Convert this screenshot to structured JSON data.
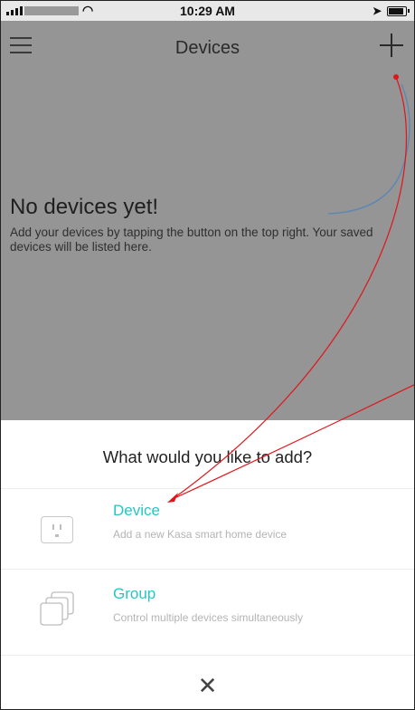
{
  "status_bar": {
    "time": "10:29 AM"
  },
  "nav": {
    "title": "Devices"
  },
  "empty_state": {
    "title": "No devices yet!",
    "subtitle": "Add your devices by tapping the button on the top right. Your saved devices will be listed here."
  },
  "sheet": {
    "title": "What would you like to add?",
    "options": [
      {
        "label": "Device",
        "description": "Add a new Kasa smart home device",
        "icon": "outlet-icon"
      },
      {
        "label": "Group",
        "description": "Control multiple devices simultaneously",
        "icon": "stacked-squares-icon"
      }
    ],
    "close_icon": "close-icon"
  },
  "colors": {
    "accent": "#26c7c2",
    "annotation": "#e0151b",
    "dim_overlay": "#959595"
  }
}
